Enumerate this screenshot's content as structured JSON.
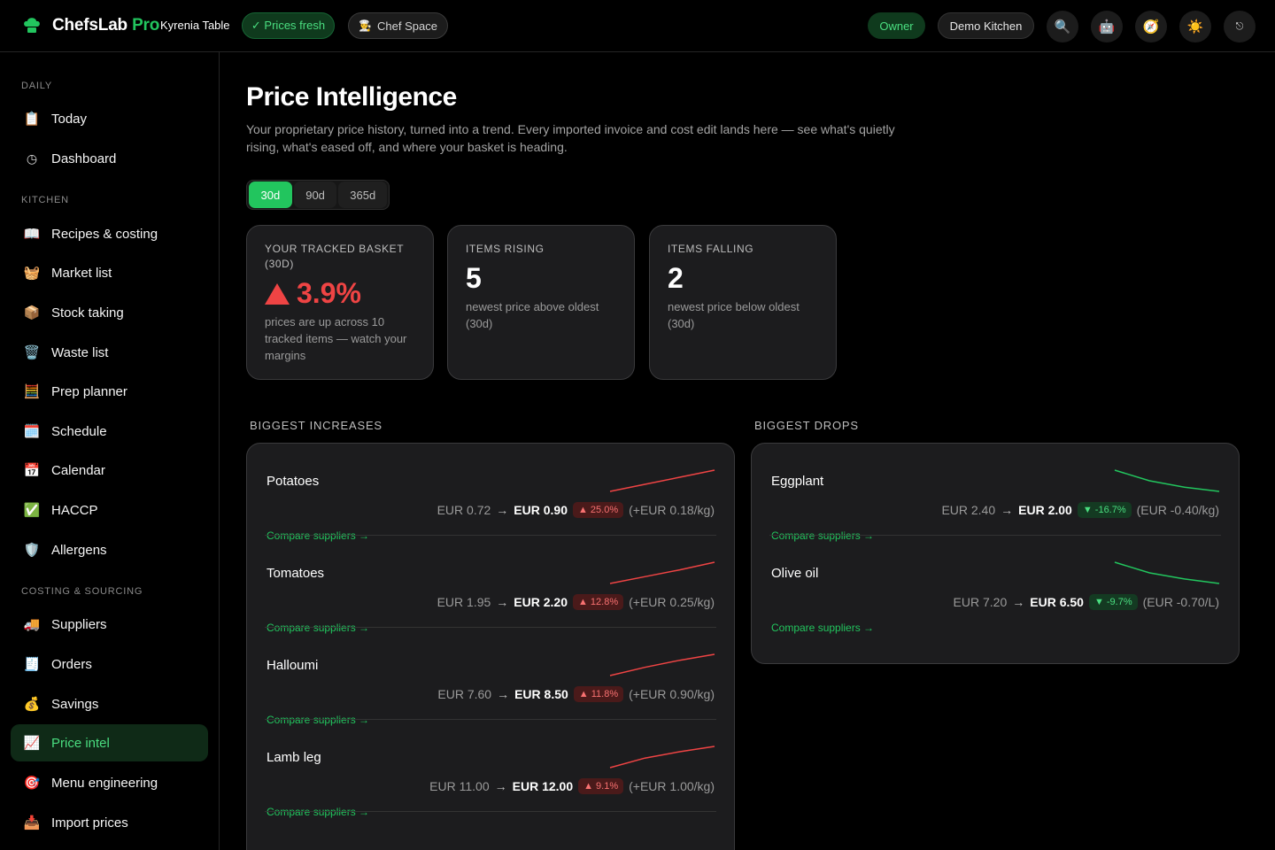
{
  "topbar": {
    "brand_name": "ChefsLab",
    "brand_suffix": "Pro",
    "kitchen": "Kyrenia Table",
    "prices_fresh": "✓ Prices fresh",
    "chef_space": "Chef Space",
    "role": "Owner",
    "workspace": "Demo Kitchen",
    "icons": [
      "search-icon",
      "robot-icon",
      "compass-icon",
      "sun-icon",
      "logout-icon"
    ]
  },
  "sidebar": {
    "sections": [
      {
        "title": "DAILY",
        "items": [
          {
            "label": "Today",
            "icon": "clipboard-icon"
          },
          {
            "label": "Dashboard",
            "icon": "clock-icon"
          }
        ]
      },
      {
        "title": "KITCHEN",
        "items": [
          {
            "label": "Recipes & costing",
            "icon": "book-icon"
          },
          {
            "label": "Market list",
            "icon": "basket-icon"
          },
          {
            "label": "Stock taking",
            "icon": "box-icon"
          },
          {
            "label": "Waste list",
            "icon": "waste-bin-icon"
          },
          {
            "label": "Prep planner",
            "icon": "abacus-icon"
          },
          {
            "label": "Schedule",
            "icon": "calendar-grid-icon"
          },
          {
            "label": "Calendar",
            "icon": "calendar-icon"
          },
          {
            "label": "HACCP",
            "icon": "check-box-icon"
          },
          {
            "label": "Allergens",
            "icon": "shield-icon"
          }
        ]
      },
      {
        "title": "COSTING & SOURCING",
        "items": [
          {
            "label": "Suppliers",
            "icon": "truck-icon"
          },
          {
            "label": "Orders",
            "icon": "receipt-icon"
          },
          {
            "label": "Savings",
            "icon": "money-bag-icon"
          },
          {
            "label": "Price intel",
            "icon": "chart-icon",
            "active": true
          },
          {
            "label": "Menu engineering",
            "icon": "target-icon"
          },
          {
            "label": "Import prices",
            "icon": "inbox-icon"
          }
        ]
      }
    ]
  },
  "page": {
    "title": "Price Intelligence",
    "description": "Your proprietary price history, turned into a trend. Every imported invoice and cost edit lands here — see what's quietly rising, what's eased off, and where your basket is heading.",
    "ranges": [
      "30d",
      "90d",
      "365d"
    ],
    "active_range": "30d"
  },
  "stats": {
    "basket": {
      "label": "YOUR TRACKED BASKET (30D)",
      "value": "3.9%",
      "direction": "up",
      "sub": "prices are up across 10 tracked items — watch your margins"
    },
    "rising": {
      "label": "ITEMS RISING",
      "value": "5",
      "sub": "newest price above oldest (30d)"
    },
    "falling": {
      "label": "ITEMS FALLING",
      "value": "2",
      "sub": "newest price below oldest (30d)"
    }
  },
  "increases": {
    "title": "BIGGEST INCREASES",
    "items": [
      {
        "name": "Potatoes",
        "old": "EUR 0.72",
        "new": "EUR 0.90",
        "pct": "▲ 25.0%",
        "delta": "(+EUR 0.18/kg)",
        "link": "Compare suppliers →",
        "trend": [
          0.72,
          0.78,
          0.84,
          0.9
        ]
      },
      {
        "name": "Tomatoes",
        "old": "EUR 1.95",
        "new": "EUR 2.20",
        "pct": "▲ 12.8%",
        "delta": "(+EUR 0.25/kg)",
        "link": "Compare suppliers →",
        "trend": [
          1.95,
          2.03,
          2.11,
          2.2
        ]
      },
      {
        "name": "Halloumi",
        "old": "EUR 7.60",
        "new": "EUR 8.50",
        "pct": "▲ 11.8%",
        "delta": "(+EUR 0.90/kg)",
        "link": "Compare suppliers →",
        "trend": [
          7.6,
          7.95,
          8.25,
          8.5
        ]
      },
      {
        "name": "Lamb leg",
        "old": "EUR 11.00",
        "new": "EUR 12.00",
        "pct": "▲ 9.1%",
        "delta": "(+EUR 1.00/kg)",
        "link": "Compare suppliers →",
        "trend": [
          11.0,
          11.45,
          11.75,
          12.0
        ]
      }
    ]
  },
  "drops": {
    "title": "BIGGEST DROPS",
    "items": [
      {
        "name": "Eggplant",
        "old": "EUR 2.40",
        "new": "EUR 2.00",
        "pct": "▼ -16.7%",
        "delta": "(EUR -0.40/kg)",
        "link": "Compare suppliers →",
        "trend": [
          2.4,
          2.2,
          2.08,
          2.0
        ]
      },
      {
        "name": "Olive oil",
        "old": "EUR 7.20",
        "new": "EUR 6.50",
        "pct": "▼ -9.7%",
        "delta": "(EUR -0.70/L)",
        "link": "Compare suppliers →",
        "trend": [
          7.2,
          6.85,
          6.65,
          6.5
        ]
      }
    ]
  },
  "colors": {
    "accent": "#22c55e",
    "rising": "#ef4444",
    "falling": "#22c55e"
  }
}
